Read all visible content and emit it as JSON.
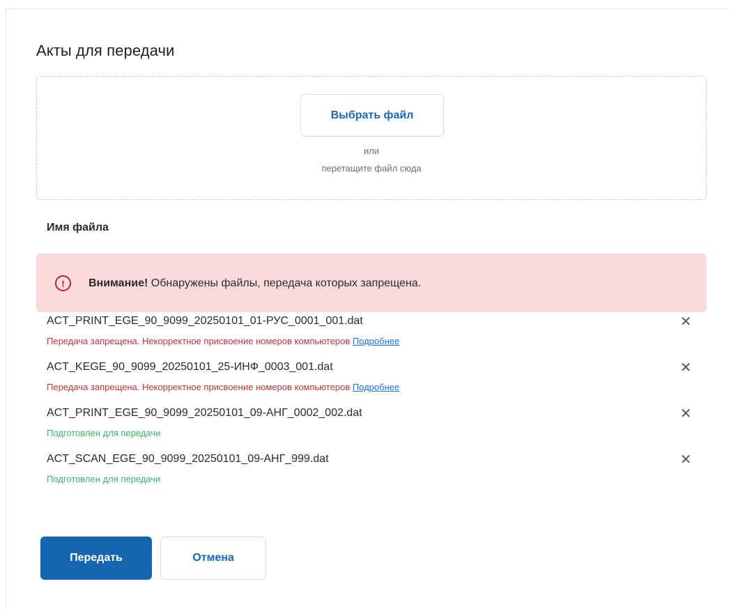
{
  "dialog": {
    "title": "Акты для передачи"
  },
  "dropzone": {
    "choose_label": "Выбрать файл",
    "or_label": "или",
    "drag_label": "перетащите файл сюда"
  },
  "list": {
    "column_header": "Имя файла"
  },
  "alert": {
    "icon": "exclamation-circle-icon",
    "bold": "Внимание!",
    "message": " Обнаружены файлы, передача которых запрещена."
  },
  "files": [
    {
      "name": "ACT_PRINT_EGE_90_9099_20250101_01-РУС_0001_001.dat",
      "status": "Передача запрещена. Некорректное присвоение номеров компьютеров",
      "link": "Подробнее",
      "state": "error"
    },
    {
      "name": "ACT_KEGE_90_9099_20250101_25-ИНФ_0003_001.dat",
      "status": "Передача запрещена. Некорректное присвоение номеров компьютеров",
      "link": "Подробнее",
      "state": "error"
    },
    {
      "name": "ACT_PRINT_EGE_90_9099_20250101_09-АНГ_0002_002.dat",
      "status": "Подготовлен для передачи",
      "state": "ok"
    },
    {
      "name": "ACT_SCAN_EGE_90_9099_20250101_09-АНГ_999.dat",
      "status": "Подготовлен для передачи",
      "state": "ok"
    }
  ],
  "actions": {
    "submit_label": "Передать",
    "cancel_label": "Отмена"
  },
  "colors": {
    "primary": "#1565b0",
    "error_text": "#c0353a",
    "ok_text": "#38b56a",
    "alert_bg": "#fadbdd",
    "link": "#1a73e8"
  }
}
